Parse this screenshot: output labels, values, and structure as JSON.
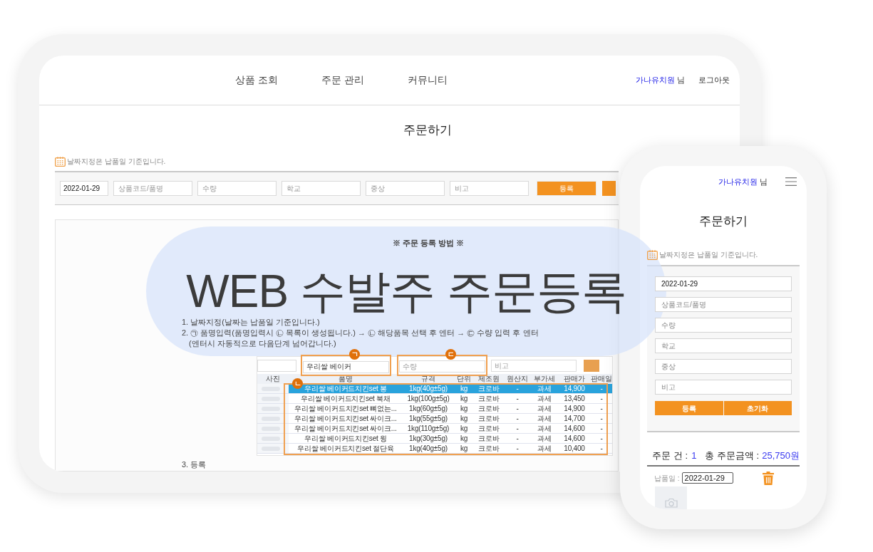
{
  "tablet": {
    "nav": {
      "links": [
        {
          "label": "상품 조회"
        },
        {
          "label": "주문 관리"
        },
        {
          "label": "커뮤니티"
        }
      ],
      "user_name": "가나유치원",
      "honorific": "님",
      "logout": "로그아웃"
    },
    "title": "주문하기",
    "note": "날짜지정은 납품일 기준입니다.",
    "form": {
      "fields": [
        {
          "kind": "value",
          "value": "2022-01-29"
        },
        {
          "kind": "placeholder",
          "placeholder": "상품코드/품명"
        },
        {
          "kind": "placeholder",
          "placeholder": "수량"
        },
        {
          "kind": "placeholder",
          "placeholder": "학교"
        },
        {
          "kind": "placeholder",
          "placeholder": "중상"
        },
        {
          "kind": "placeholder",
          "placeholder": "비고"
        }
      ],
      "buttons": [
        {
          "kind": "labeled",
          "label": "등록"
        },
        {
          "kind": "covered"
        }
      ]
    },
    "guide": {
      "heading": "※ 주문 등록 방법 ※",
      "steps": [
        {
          "text": "1. 날짜지정(날짜는 납품일 기준입니다.)"
        },
        {
          "text": "2. ㉠ 품명입력(품명입력시 ㉡ 목록이 생성됩니다.) → ㉡ 해당품목 선택 후 엔터 → ㉢ 수량 입력 후 엔터",
          "note": "(엔터시 자동적으로 다음단계 넘어갑니다.)"
        }
      ],
      "example": {
        "search_fields": [
          {
            "kind": "empty"
          },
          {
            "kind": "value",
            "value": "우리쌀 베이커",
            "marker": "ㄱ"
          },
          {
            "kind": "placeholder",
            "placeholder": "수량",
            "marker": "ㄷ"
          },
          {
            "kind": "placeholder",
            "placeholder": "비고"
          }
        ],
        "search_buttons": [
          {
            "kind": "covered"
          }
        ],
        "photo_column": "사진",
        "columns": [
          "품명",
          "규격",
          "단위",
          "제조원",
          "원산지",
          "부가세",
          "판매가",
          "판매일"
        ],
        "rows_marker": "ㄴ",
        "rows": [
          {
            "selected": true,
            "cells": [
              "우리쌀 베이커드치킨set 봉",
              "1kg(40g±5g)",
              "kg",
              "크로바",
              "-",
              "과세",
              "14,900",
              "-"
            ]
          },
          {
            "selected": false,
            "cells": [
              "우리쌀 베이커드치킨set 북채",
              "1kg(100g±5g)",
              "kg",
              "크로바",
              "-",
              "과세",
              "13,450",
              "-"
            ]
          },
          {
            "selected": false,
            "cells": [
              "우리쌀 베이커드치킨set 뼈없는...",
              "1kg(60g±5g)",
              "kg",
              "크로바",
              "-",
              "과세",
              "14,900",
              "-"
            ]
          },
          {
            "selected": false,
            "cells": [
              "우리쌀 베이커드치킨set 싸이크...",
              "1kg(55g±5g)",
              "kg",
              "크로바",
              "-",
              "과세",
              "14,700",
              "-"
            ]
          },
          {
            "selected": false,
            "cells": [
              "우리쌀 베이커드치킨set 싸이크...",
              "1kg(110g±5g)",
              "kg",
              "크로바",
              "-",
              "과세",
              "14,600",
              "-"
            ]
          },
          {
            "selected": false,
            "cells": [
              "우리쌀 베이커드치킨set 윙",
              "1kg(30g±5g)",
              "kg",
              "크로바",
              "-",
              "과세",
              "14,600",
              "-"
            ]
          },
          {
            "selected": false,
            "cells": [
              "우리쌀 베이커드치킨set 절단육",
              "1kg(40g±5g)",
              "kg",
              "크로바",
              "-",
              "과세",
              "10,400",
              "-"
            ]
          }
        ]
      },
      "last_step": "3. 등록"
    }
  },
  "banner": {
    "title": "WEB 수발주 주문등록"
  },
  "phone": {
    "user_name": "가나유치원",
    "honorific": "님",
    "title": "주문하기",
    "note": "날짜지정은 납품일 기준입니다.",
    "form": {
      "fields": [
        {
          "kind": "value",
          "value": "2022-01-29"
        },
        {
          "kind": "placeholder",
          "placeholder": "상품코드/품명"
        },
        {
          "kind": "placeholder",
          "placeholder": "수량"
        },
        {
          "kind": "placeholder",
          "placeholder": "학교"
        },
        {
          "kind": "placeholder",
          "placeholder": "중상"
        },
        {
          "kind": "placeholder",
          "placeholder": "비고"
        }
      ],
      "buttons": [
        "등록",
        "초기화"
      ]
    },
    "summary": {
      "count_label": "주문 건 :",
      "count": "1",
      "total_label": "총 주문금액 :",
      "total": "25,750원"
    },
    "order": {
      "date_label": "납품일 :",
      "date": "2022-01-29"
    }
  }
}
